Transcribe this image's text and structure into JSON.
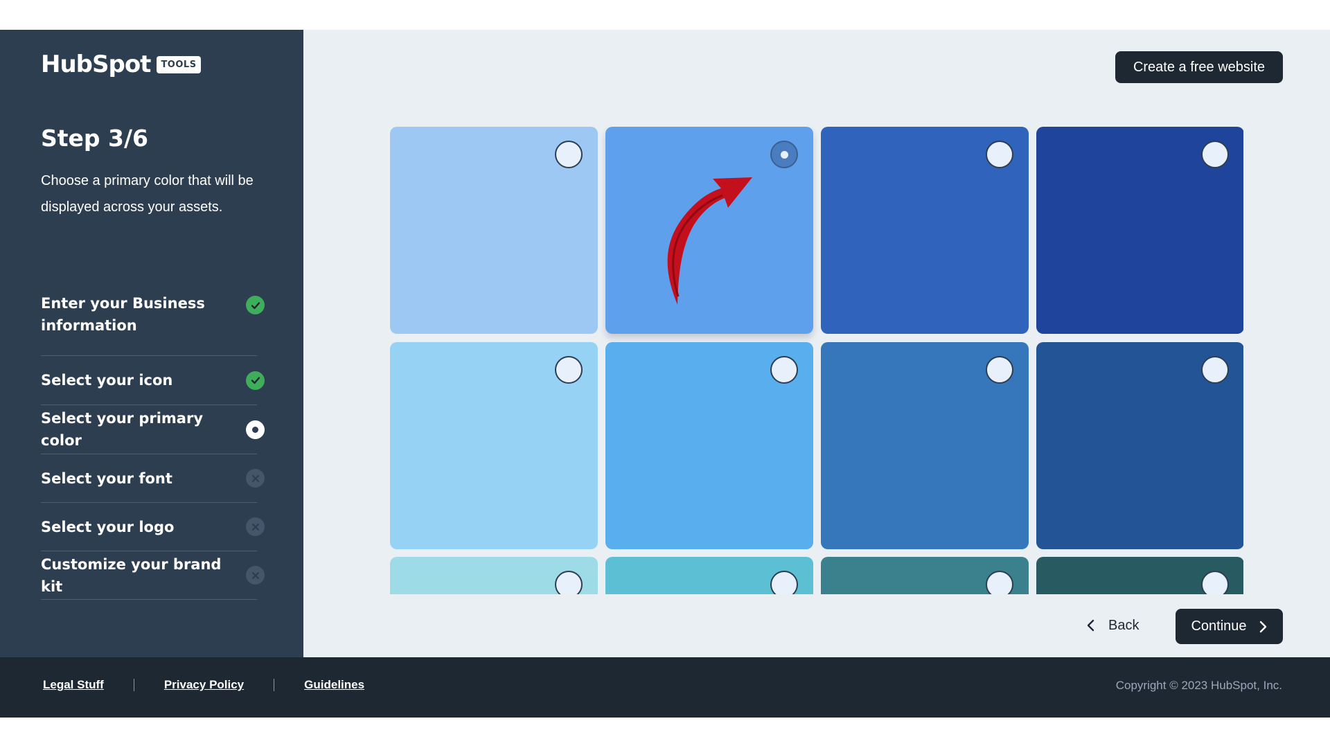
{
  "brand": {
    "word": "HubSpot",
    "badge": "TOOLS"
  },
  "sidebar": {
    "step_title": "Step 3/6",
    "description": "Choose a primary color that will be displayed across your assets.",
    "steps": [
      {
        "label": "Enter your Business information",
        "status": "done"
      },
      {
        "label": "Select your icon",
        "status": "done"
      },
      {
        "label": "Select your primary color",
        "status": "current"
      },
      {
        "label": "Select your font",
        "status": "pending"
      },
      {
        "label": "Select your logo",
        "status": "pending"
      },
      {
        "label": "Customize your brand kit",
        "status": "pending"
      }
    ]
  },
  "header": {
    "create_label": "Create a free website"
  },
  "palette": {
    "selected_index": 1,
    "colors": [
      "#9dc8f3",
      "#5fa0ed",
      "#3063bb",
      "#1f449b",
      "#96d2f4",
      "#59aeee",
      "#3676bb",
      "#235596",
      "#9ddbe7",
      "#5cbfd4",
      "#3b808d",
      "#285a62"
    ]
  },
  "nav": {
    "back_label": "Back",
    "continue_label": "Continue"
  },
  "footer": {
    "links": [
      "Legal Stuff",
      "Privacy Policy",
      "Guidelines"
    ],
    "copyright": "Copyright © 2023 HubSpot, Inc."
  },
  "accent_colors": {
    "sidebar_bg": "#2d3e50",
    "footer_bg": "#1e2833",
    "success": "#3fae5a",
    "arrow": "#d0021b"
  }
}
